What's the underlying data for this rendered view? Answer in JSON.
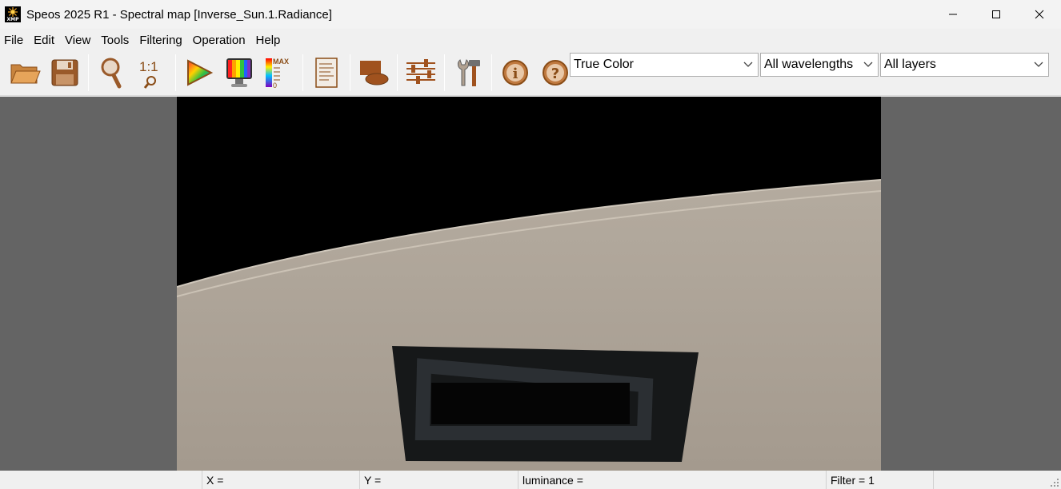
{
  "window": {
    "title": "Speos 2025 R1 - Spectral map [Inverse_Sun.1.Radiance]",
    "app_icon_text": "XMP",
    "minimize_icon": "minimize-icon",
    "maximize_icon": "maximize-icon",
    "close_icon": "close-icon"
  },
  "menu": {
    "items": [
      {
        "label": "File"
      },
      {
        "label": "Edit"
      },
      {
        "label": "View"
      },
      {
        "label": "Tools"
      },
      {
        "label": "Filtering"
      },
      {
        "label": "Operation"
      },
      {
        "label": "Help"
      }
    ]
  },
  "toolbar": {
    "buttons": [
      {
        "icon": "open-folder-icon"
      },
      {
        "icon": "save-disk-icon"
      },
      {
        "icon": "zoom-magnifier-icon"
      },
      {
        "icon": "zoom-1to1-icon",
        "label": "1:1"
      },
      {
        "icon": "color-triangle-icon"
      },
      {
        "icon": "spectrum-monitor-icon"
      },
      {
        "icon": "color-scale-max-icon",
        "label_max": "MAX",
        "label_min": "0"
      },
      {
        "icon": "report-document-icon"
      },
      {
        "icon": "layer-shapes-icon"
      },
      {
        "icon": "sliders-settings-icon"
      },
      {
        "icon": "tools-wrench-hammer-icon"
      },
      {
        "icon": "info-icon",
        "label": "i"
      },
      {
        "icon": "help-question-icon",
        "label": "?"
      }
    ],
    "color_mode": {
      "value": "True Color"
    },
    "wavelength": {
      "value": "All wavelengths"
    },
    "layer": {
      "value": "All layers"
    }
  },
  "statusbar": {
    "x": "X =",
    "y": "Y =",
    "luminance": "luminance =",
    "filter": "Filter = 1"
  },
  "colors": {
    "canvas_background": "#646464",
    "sky": "#000000",
    "surface": "#a89e92",
    "icon_brown": "#a0521e"
  }
}
